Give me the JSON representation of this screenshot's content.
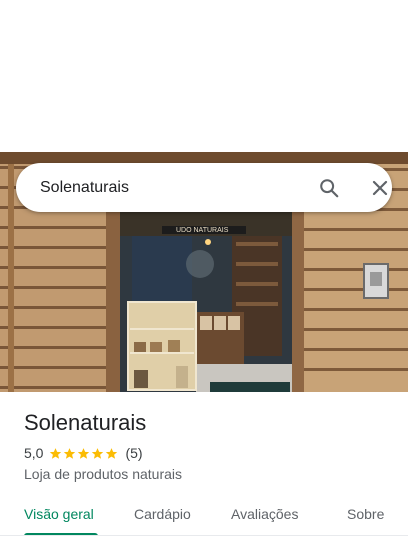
{
  "search": {
    "query": "Solenaturais"
  },
  "place": {
    "name": "Solenaturais",
    "rating": "5,0",
    "stars": 5,
    "review_count": "(5)",
    "category": "Loja de produtos naturais"
  },
  "photo": {
    "sign_text": "UDO NATURAIS"
  },
  "tabs": [
    {
      "label": "Visão geral",
      "active": true
    },
    {
      "label": "Cardápio",
      "active": false
    },
    {
      "label": "Avaliações",
      "active": false
    },
    {
      "label": "Sobre",
      "active": false
    }
  ],
  "colors": {
    "accent": "#01875f",
    "star": "#fbbc04"
  },
  "icons": {
    "search": "search-icon",
    "close": "close-icon",
    "star": "star-icon"
  }
}
